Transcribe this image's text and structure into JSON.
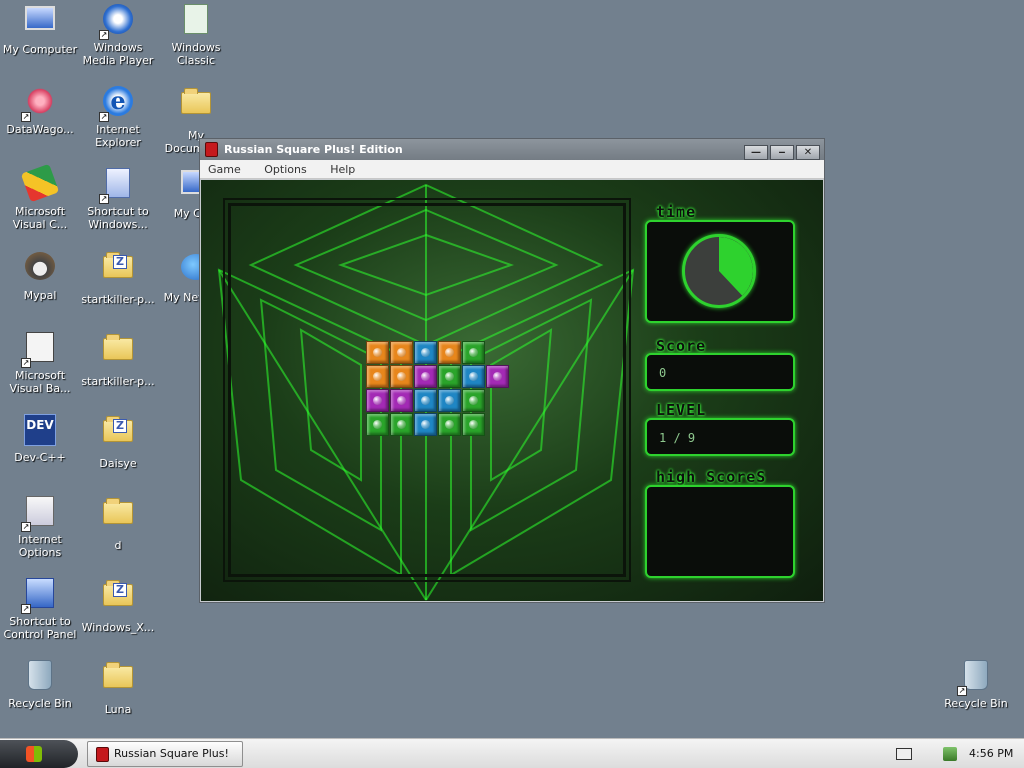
{
  "desktop": {
    "col1": [
      {
        "label": "My Computer"
      },
      {
        "label": "DataWago..."
      },
      {
        "label": "Microsoft Visual C..."
      },
      {
        "label": "Mypal"
      },
      {
        "label": "Microsoft Visual Ba..."
      },
      {
        "label": "Dev-C++"
      },
      {
        "label": "Internet Options"
      },
      {
        "label": "Shortcut to Control Panel"
      },
      {
        "label": "Recycle Bin"
      }
    ],
    "col2": [
      {
        "label": "Windows Media Player"
      },
      {
        "label": "Internet Explorer"
      },
      {
        "label": "Shortcut to Windows..."
      },
      {
        "label": "startkiller-p..."
      },
      {
        "label": "startkiller-p..."
      },
      {
        "label": "Daisye"
      },
      {
        "label": "d"
      },
      {
        "label": "Windows_X..."
      },
      {
        "label": "Luna"
      }
    ],
    "col3": [
      {
        "label": "Windows Classic"
      },
      {
        "label": "My Documents"
      },
      {
        "label": "My Com"
      },
      {
        "label": "My Net Plac"
      }
    ],
    "right": {
      "label": "Recycle Bin"
    },
    "dev_icon_text": "DEV",
    "zip_text": "Z"
  },
  "window": {
    "title": "Russian Square Plus! Edition",
    "buttons": {
      "minimize": "—",
      "restore": "‒",
      "close": "✕"
    },
    "menu": [
      "Game",
      "Options",
      "Help"
    ]
  },
  "game": {
    "time_label": "time",
    "time_remaining_fraction": 0.38,
    "score_label": "Score",
    "score_value": "0",
    "level_label": "LEVEL",
    "level_value": "1 / 9",
    "highscores_label": "high ScoreS",
    "colors": {
      "orange": "#e7861c",
      "blue": "#1f86c4",
      "green": "#2aa42a",
      "purple": "#a32ab5",
      "accent": "#2ed22e"
    },
    "blocks": [
      [
        "orange",
        "orange",
        "blue",
        "orange",
        "green",
        null
      ],
      [
        "orange",
        "orange",
        "purple",
        "green",
        "blue",
        "purple"
      ],
      [
        "purple",
        "purple",
        "blue",
        "blue",
        "green",
        null
      ],
      [
        "green",
        "green",
        "blue",
        "green",
        "green",
        null
      ]
    ]
  },
  "taskbar": {
    "task_label": "Russian Square Plus! ...",
    "clock": "4:56 PM"
  }
}
